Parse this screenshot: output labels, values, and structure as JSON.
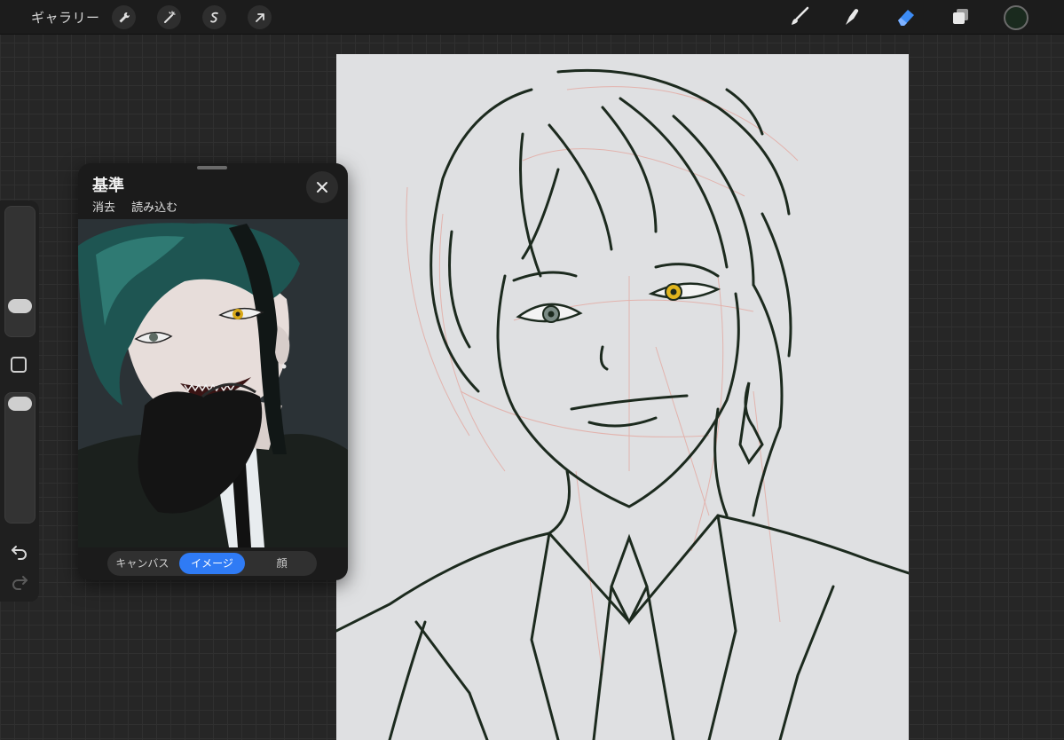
{
  "topbar": {
    "gallery_label": "ギャラリー",
    "left_tools": [
      "wrench-icon",
      "magic-wand-icon",
      "selection-icon",
      "transform-arrow-icon"
    ],
    "right_tools": [
      "brush-icon",
      "smudge-icon",
      "eraser-icon",
      "layers-icon"
    ],
    "current_color": "#1a2a1e",
    "accent": "#3d8cf5"
  },
  "reference_panel": {
    "title": "基準",
    "actions": [
      "消去",
      "読み込む"
    ],
    "tabs": [
      {
        "label": "キャンバス",
        "active": false
      },
      {
        "label": "イメージ",
        "active": true
      },
      {
        "label": "顔",
        "active": false
      }
    ]
  },
  "sidebar": {
    "brush_size_level": 0.22,
    "opacity_level": 0.05
  }
}
